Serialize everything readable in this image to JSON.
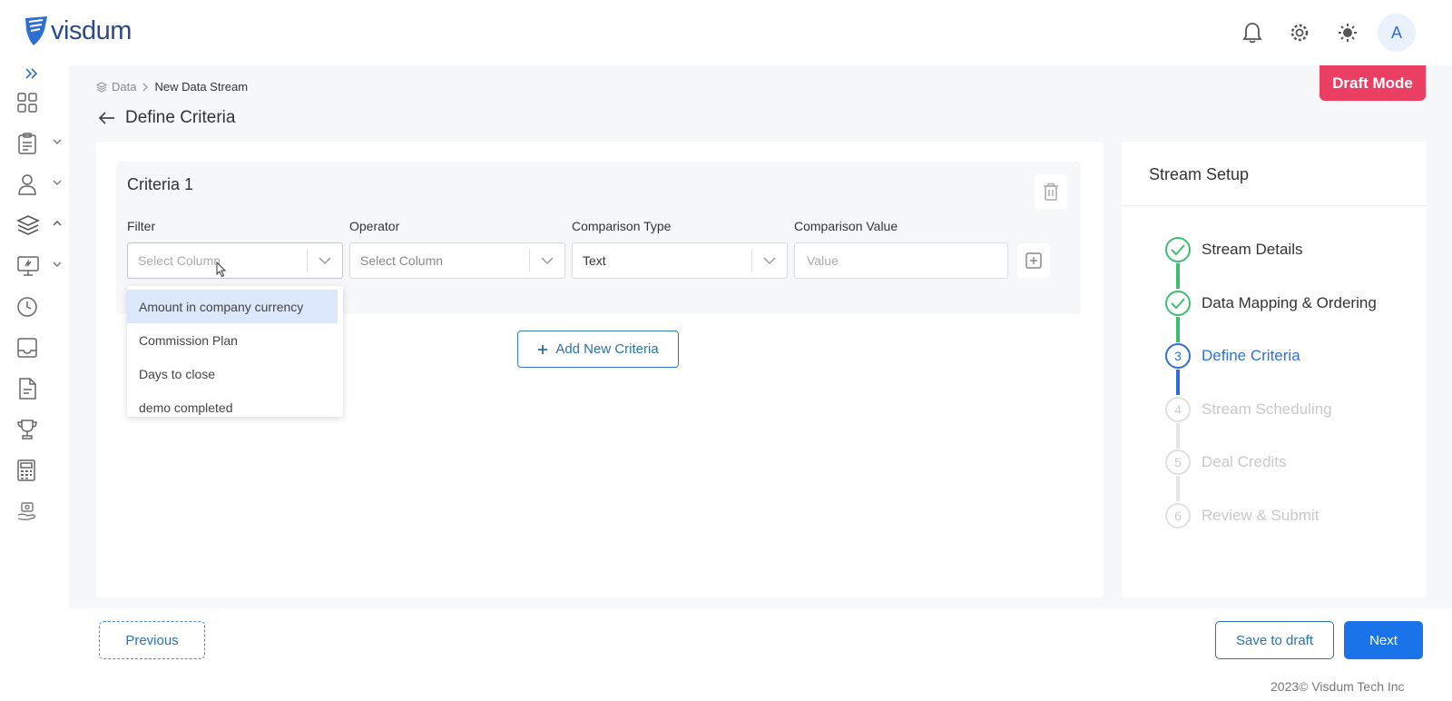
{
  "app": {
    "logo_text": "visdum"
  },
  "header": {
    "avatar_initial": "A"
  },
  "breadcrumb": {
    "parent": "Data",
    "current": "New Data Stream"
  },
  "page": {
    "title": "Define Criteria",
    "draft_badge": "Draft Mode"
  },
  "criteria": {
    "title": "Criteria 1",
    "filter_label": "Filter",
    "operator_label": "Operator",
    "comparison_type_label": "Comparison Type",
    "comparison_value_label": "Comparison Value",
    "filter_placeholder": "Select Column",
    "operator_placeholder": "Select Column",
    "comparison_type_value": "Text",
    "comparison_value_placeholder": "Value",
    "dropdown_options": [
      "Amount in company currency",
      "Commission Plan",
      "Days to close",
      "demo completed"
    ],
    "add_button": "Add New Criteria"
  },
  "setup": {
    "title": "Stream Setup",
    "steps": [
      {
        "number": "",
        "label": "Stream Details",
        "state": "done"
      },
      {
        "number": "",
        "label": "Data Mapping & Ordering",
        "state": "done"
      },
      {
        "number": "3",
        "label": "Define Criteria",
        "state": "active"
      },
      {
        "number": "4",
        "label": "Stream Scheduling",
        "state": "pending"
      },
      {
        "number": "5",
        "label": "Deal Credits",
        "state": "pending"
      },
      {
        "number": "6",
        "label": "Review & Submit",
        "state": "pending"
      }
    ]
  },
  "footer": {
    "previous": "Previous",
    "save_draft": "Save to draft",
    "next": "Next",
    "copyright": "2023© Visdum Tech Inc"
  },
  "colors": {
    "primary": "#1a73e8",
    "draft": "#ea3e62",
    "done": "#3dbd6e",
    "active": "#2f6fd1",
    "pending": "#c8c8c8"
  }
}
